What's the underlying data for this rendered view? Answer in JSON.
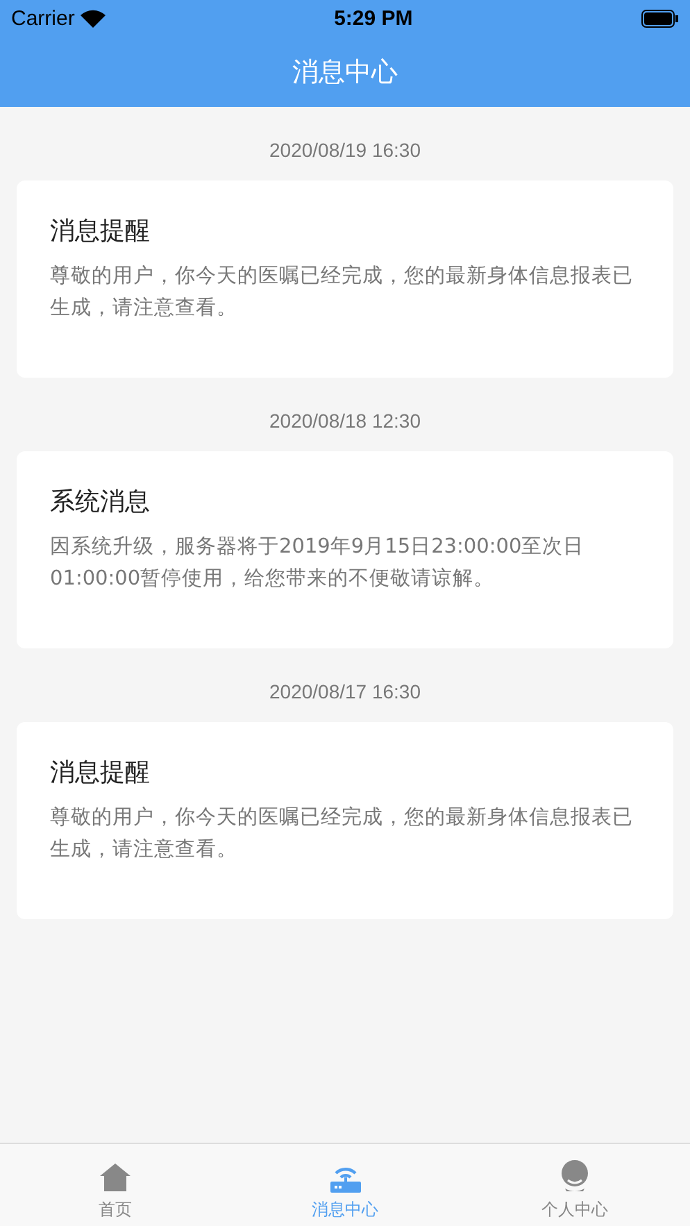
{
  "status_bar": {
    "carrier": "Carrier",
    "time": "5:29 PM"
  },
  "nav": {
    "title": "消息中心"
  },
  "messages": [
    {
      "date": "2020/08/19 16:30",
      "title": "消息提醒",
      "body": "尊敬的用户，你今天的医嘱已经完成，您的最新身体信息报表已生成，请注意查看。"
    },
    {
      "date": "2020/08/18 12:30",
      "title": "系统消息",
      "body": "因系统升级，服务器将于2019年9月15日23:00:00至次日01:00:00暂停使用，给您带来的不便敬请谅解。"
    },
    {
      "date": "2020/08/17 16:30",
      "title": "消息提醒",
      "body": "尊敬的用户，你今天的医嘱已经完成，您的最新身体信息报表已生成，请注意查看。"
    }
  ],
  "tabs": [
    {
      "kind": "home",
      "label": "首页",
      "selected": false
    },
    {
      "kind": "messages",
      "label": "消息中心",
      "selected": true
    },
    {
      "kind": "profile",
      "label": "个人中心",
      "selected": false
    }
  ]
}
